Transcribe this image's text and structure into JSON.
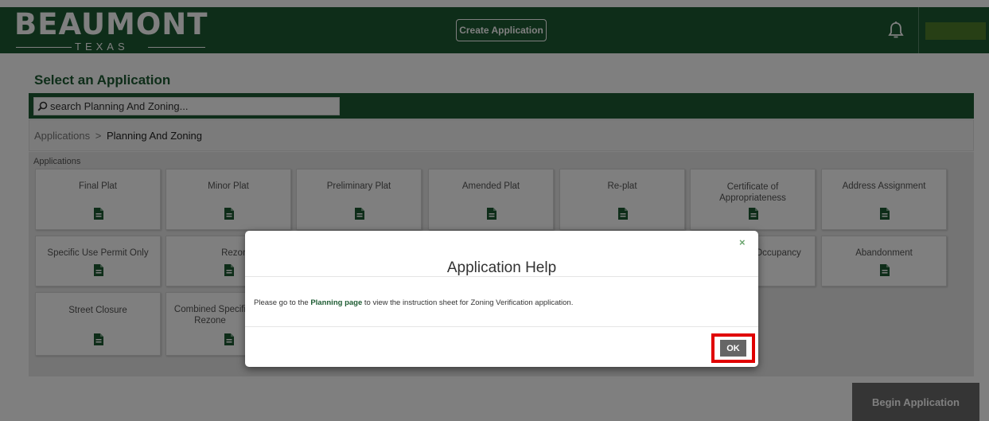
{
  "header": {
    "logo_main": "BEAUMONT",
    "logo_sub": "TEXAS",
    "create_application_label": "Create Application",
    "bell_icon": "bell-icon"
  },
  "page": {
    "title": "Select an Application",
    "search_placeholder": "search Planning And Zoning..."
  },
  "breadcrumb": {
    "root": "Applications",
    "separator": ">",
    "current": "Planning And Zoning"
  },
  "applications": {
    "label": "Applications",
    "tiles": [
      {
        "label": "Final Plat"
      },
      {
        "label": "Minor Plat"
      },
      {
        "label": "Preliminary Plat"
      },
      {
        "label": "Amended Plat"
      },
      {
        "label": "Re-plat"
      },
      {
        "label": "Certificate of Appropriateness"
      },
      {
        "label": "Address Assignment"
      },
      {
        "label": "Specific Use Permit Only"
      },
      {
        "label": "Rezone O"
      },
      {
        "label": "Occupancy"
      },
      {
        "label": "Abandonment"
      },
      {
        "label": "Street Closure"
      },
      {
        "label": "Combined Specifi Rezone"
      }
    ]
  },
  "begin_button_label": "Begin Application",
  "modal": {
    "close_glyph": "×",
    "title": "Application Help",
    "body_prefix": "Please go to the",
    "body_link": "Planning page",
    "body_suffix": "to view the instruction sheet for Zoning Verification application.",
    "ok_label": "OK"
  },
  "colors": {
    "brand_green": "#1d5b32",
    "highlight_red": "#e00000",
    "button_gray": "#666666"
  }
}
